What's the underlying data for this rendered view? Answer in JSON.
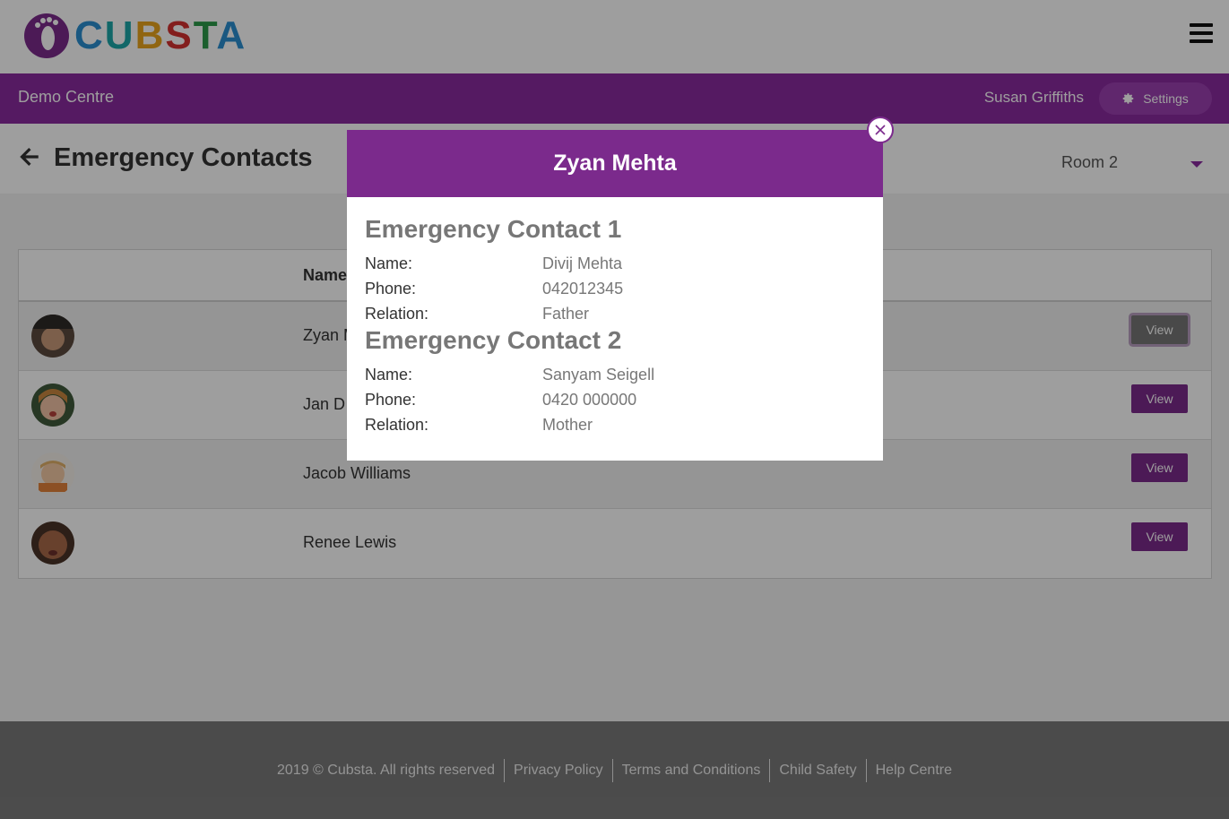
{
  "brand": {
    "logo_letters": [
      "C",
      "U",
      "B",
      "S",
      "T",
      "A"
    ]
  },
  "header": {
    "centre_name": "Demo Centre",
    "user_name": "Susan Griffiths",
    "settings_label": "Settings"
  },
  "page": {
    "title": "Emergency Contacts",
    "room_selected": "Room 2"
  },
  "table": {
    "column_name": "Name",
    "rows": [
      {
        "name": "Zyan Mehta",
        "action": "View"
      },
      {
        "name": "Jan D",
        "action": "View"
      },
      {
        "name": "Jacob Williams",
        "action": "View"
      },
      {
        "name": "Renee Lewis",
        "action": "View"
      }
    ]
  },
  "footer": {
    "copyright": "2019 © Cubsta. All rights reserved",
    "links": [
      "Privacy Policy",
      "Terms and Conditions",
      "Child Safety",
      "Help Centre"
    ]
  },
  "modal": {
    "title": "Zyan Mehta",
    "contacts": [
      {
        "heading": "Emergency Contact 1",
        "name_label": "Name:",
        "name": "Divij Mehta",
        "phone_label": "Phone:",
        "phone": "042012345",
        "relation_label": "Relation:",
        "relation": "Father"
      },
      {
        "heading": "Emergency Contact 2",
        "name_label": "Name:",
        "name": "Sanyam Seigell",
        "phone_label": "Phone:",
        "phone": "0420 000000",
        "relation_label": "Relation:",
        "relation": "Mother"
      }
    ]
  },
  "colors": {
    "brand_purple": "#8a2a9e",
    "button_purple": "#7b2a8c"
  }
}
